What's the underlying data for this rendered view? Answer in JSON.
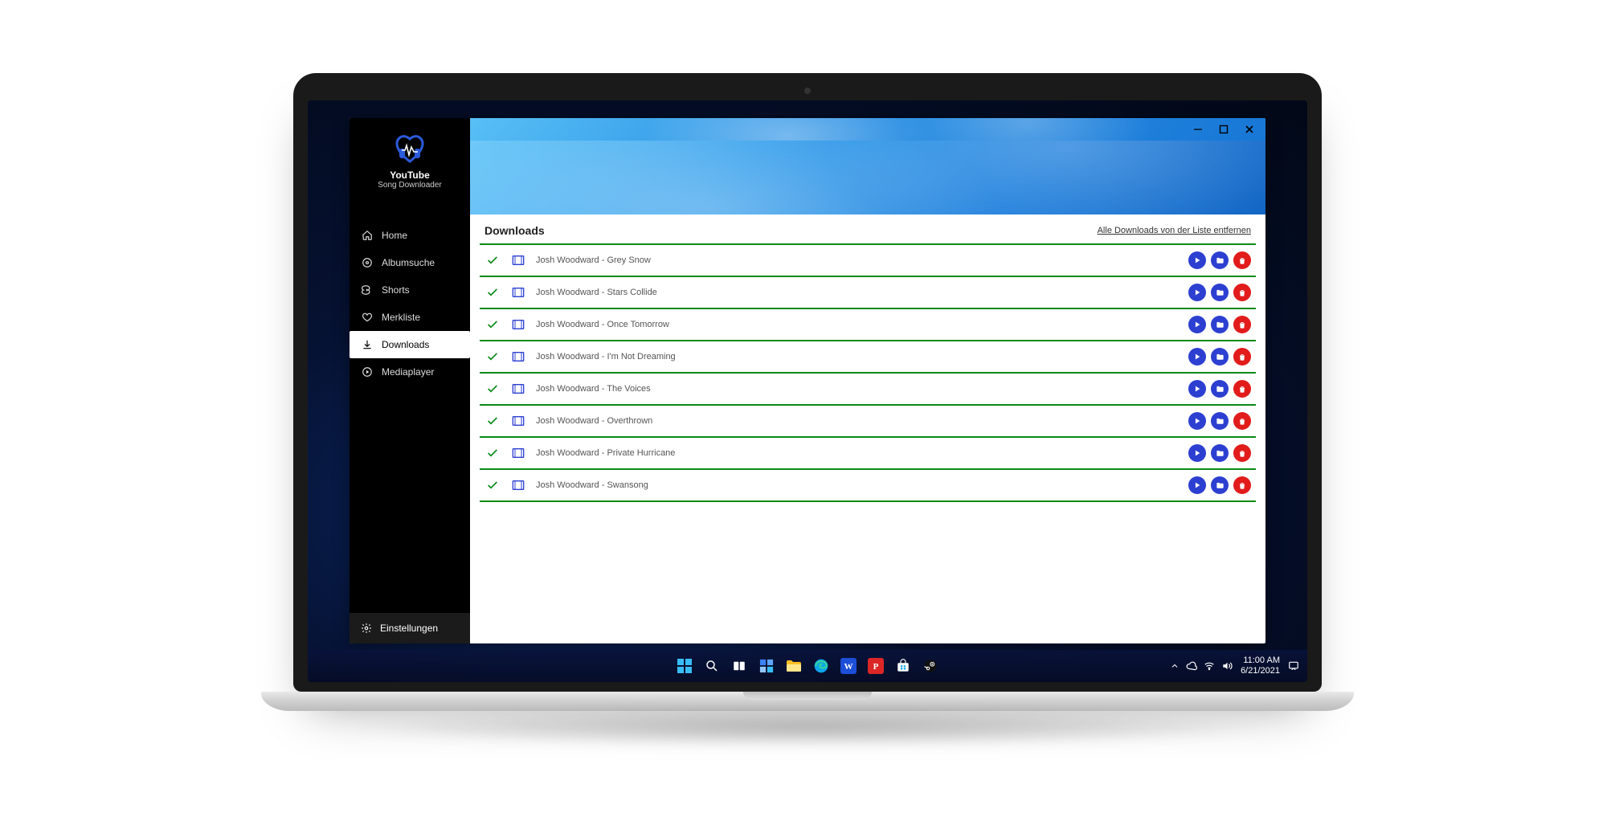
{
  "brand": {
    "title": "YouTube",
    "subtitle": "Song Downloader"
  },
  "sidebar": {
    "items": [
      {
        "label": "Home"
      },
      {
        "label": "Albumsuche"
      },
      {
        "label": "Shorts"
      },
      {
        "label": "Merkliste"
      },
      {
        "label": "Downloads"
      },
      {
        "label": "Mediaplayer"
      }
    ],
    "settings_label": "Einstellungen"
  },
  "main": {
    "heading": "Downloads",
    "clear_link": "Alle Downloads von der Liste entfernen",
    "items": [
      {
        "title": "Josh Woodward - Grey Snow"
      },
      {
        "title": "Josh Woodward - Stars Collide"
      },
      {
        "title": "Josh Woodward - Once Tomorrow"
      },
      {
        "title": "Josh Woodward - I'm Not Dreaming"
      },
      {
        "title": "Josh Woodward - The Voices"
      },
      {
        "title": "Josh Woodward - Overthrown"
      },
      {
        "title": "Josh Woodward - Private Hurricane"
      },
      {
        "title": "Josh Woodward - Swansong"
      }
    ]
  },
  "taskbar": {
    "time": "11:00 AM",
    "date": "6/21/2021"
  },
  "colors": {
    "accent_blue": "#2d3fd1",
    "danger_red": "#e21b1b",
    "progress_green": "#0a8a16"
  }
}
